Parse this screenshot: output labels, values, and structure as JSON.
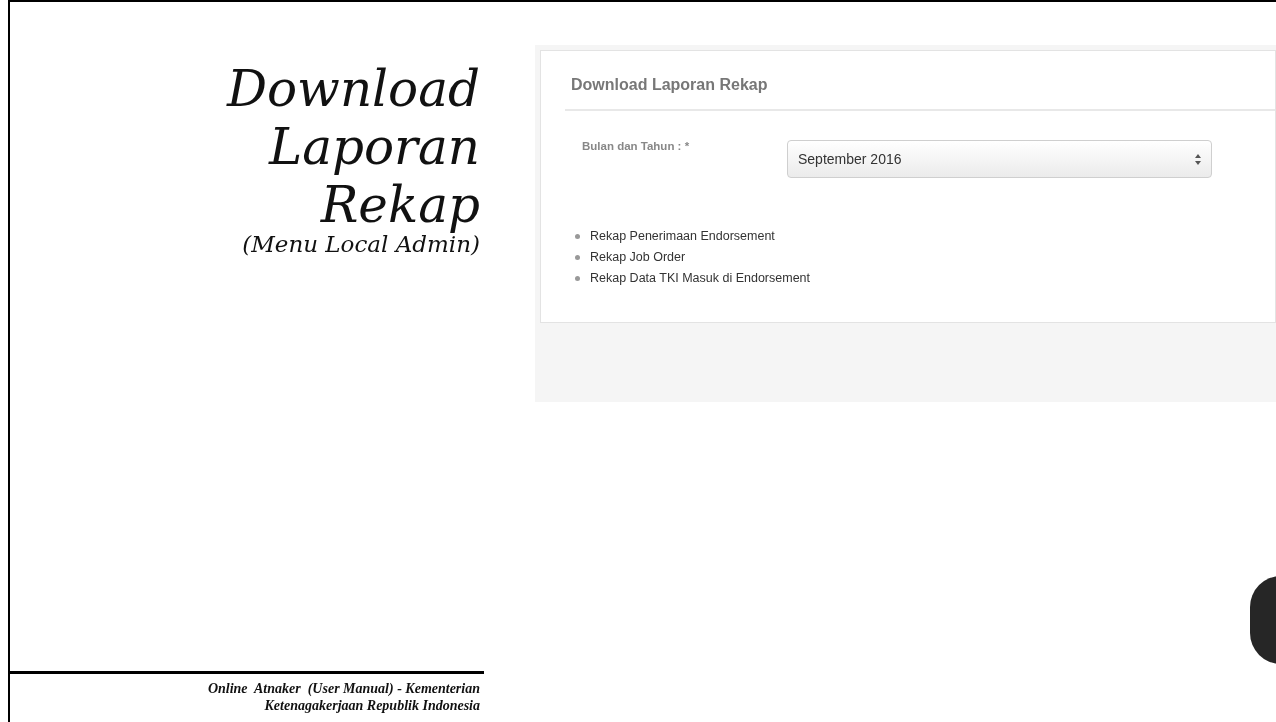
{
  "slide": {
    "title_lines": [
      "Download",
      "Laporan",
      "Rekap"
    ],
    "subtitle": "(Menu Local Admin)",
    "footer": [
      "Online  Atnaker  (User Manual) - Kementerian",
      "Ketenagakerjaan Republik Indonesia"
    ]
  },
  "screenshot": {
    "panel_title": "Download Laporan Rekap",
    "field_label": "Bulan dan Tahun : *",
    "select_value": "September 2016",
    "links": [
      "Rekap Penerimaan Endorsement",
      "Rekap Job Order",
      "Rekap Data TKI Masuk di Endorsement"
    ]
  }
}
